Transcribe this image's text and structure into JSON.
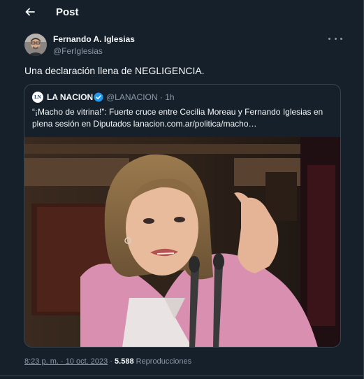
{
  "header": {
    "back_icon": "arrow-left-icon",
    "title": "Post"
  },
  "author": {
    "name": "Fernando A. Iglesias",
    "handle": "@FerIglesias",
    "avatar_icon": "profile-photo"
  },
  "tweet": {
    "text": "Una declaración llena de NEGLIGENCIA."
  },
  "quote": {
    "source_name": "LA NACION",
    "logo_text": "LN",
    "verified_icon": "verified-badge-icon",
    "handle_time": "@LANACION · 1h",
    "text": "“¡Macho de vitrina!”: Fuerte cruce entre Cecilia Moreau y Fernando Iglesias en plena sesión en Diputados lanacion.com.ar/politica/macho…",
    "media_description_icon": "photo"
  },
  "meta": {
    "time": "8:23 p. m. · 10 oct. 2023",
    "separator": " · ",
    "views_count": "5.588",
    "views_label": "Reproducciones"
  },
  "colors": {
    "background": "#15202b",
    "border": "#38444d",
    "text_primary": "#f7f9f9",
    "text_secondary": "#8b98a5",
    "verified": "#1d9bf0"
  }
}
